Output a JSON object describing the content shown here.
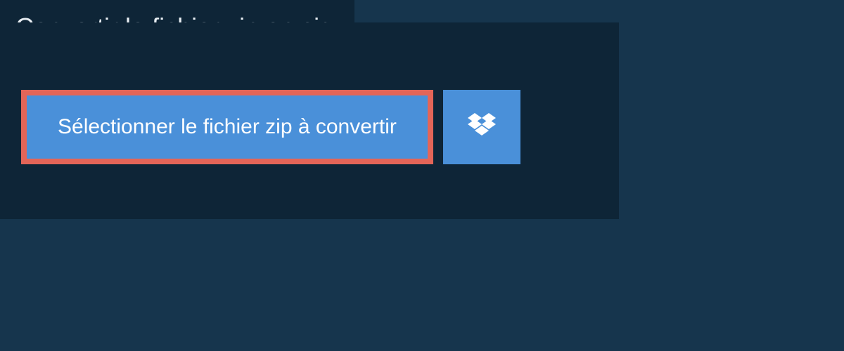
{
  "header": {
    "title": "Convertir le fichier zip en sig"
  },
  "actions": {
    "select_label": "Sélectionner le fichier zip à convertir"
  },
  "colors": {
    "background": "#16354d",
    "panel": "#0e2537",
    "button": "#4a90d9",
    "highlight": "#e36558",
    "text_light": "#e8eef3"
  }
}
